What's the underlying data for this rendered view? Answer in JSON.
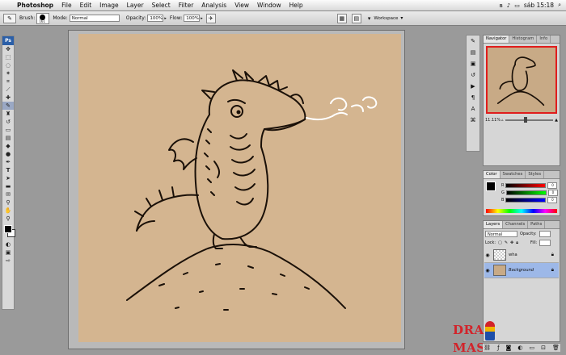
{
  "menubar": {
    "app_name": "Photoshop",
    "items": [
      "File",
      "Edit",
      "Image",
      "Layer",
      "Select",
      "Filter",
      "Analysis",
      "View",
      "Window",
      "Help"
    ],
    "clock": "sáb 15:18"
  },
  "options": {
    "brush_label": "Brush:",
    "brush_size": "161",
    "mode_label": "Mode:",
    "mode_value": "Normal",
    "opacity_label": "Opacity:",
    "opacity_value": "100%",
    "flow_label": "Flow:",
    "flow_value": "100%",
    "workspace_label": "Workspace"
  },
  "toolbox": {
    "logo": "Ps"
  },
  "navigator": {
    "tabs": [
      "Navigator",
      "Histogram",
      "Info"
    ],
    "zoom": "11.11%"
  },
  "color": {
    "tabs": [
      "Color",
      "Swatches",
      "Styles"
    ],
    "channels": [
      {
        "name": "R",
        "value": "0"
      },
      {
        "name": "G",
        "value": "0"
      },
      {
        "name": "B",
        "value": "0"
      }
    ]
  },
  "layers": {
    "tabs": [
      "Layers",
      "Channels",
      "Paths"
    ],
    "blend_mode": "Normal",
    "opacity_label": "Opacity:",
    "lock_label": "Lock:",
    "fill_label": "Fill:",
    "items": [
      {
        "name": "wha",
        "selected": false
      },
      {
        "name": "Background",
        "selected": true
      }
    ]
  },
  "watermark": {
    "part1": "DRA",
    "part2": "MASTER.RU"
  },
  "colors": {
    "paper": "#d4b590",
    "accent": "#e01d1d",
    "selection": "#9db8e8"
  }
}
